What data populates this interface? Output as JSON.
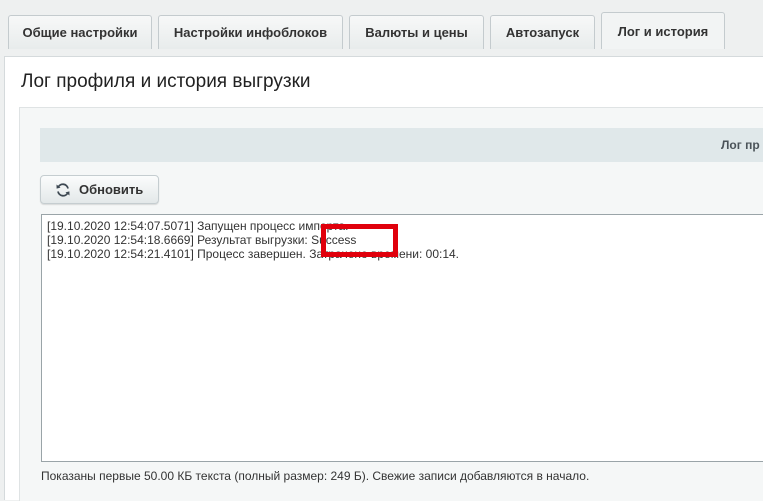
{
  "tabs": [
    {
      "label": "Общие настройки",
      "active": false
    },
    {
      "label": "Настройки инфоблоков",
      "active": false
    },
    {
      "label": "Валюты и цены",
      "active": false
    },
    {
      "label": "Автозапуск",
      "active": false
    },
    {
      "label": "Лог и история",
      "active": true
    }
  ],
  "page": {
    "title": "Лог профиля и история выгрузки"
  },
  "section": {
    "header_label": "Лог пр"
  },
  "toolbar": {
    "refresh_label": "Обновить",
    "refresh_icon": "refresh-icon"
  },
  "log": {
    "lines": [
      "[19.10.2020 12:54:07.5071] Запущен процесс импорта.",
      "[19.10.2020 12:54:18.6669] Результат выгрузки: Success",
      "[19.10.2020 12:54:21.4101] Процесс завершен. Затрачено времени: 00:14."
    ],
    "highlight_color": "#e0000c"
  },
  "footnote": "Показаны первые 50.00 КБ текста (полный размер: 249 Б). Свежие записи добавляются в начало."
}
